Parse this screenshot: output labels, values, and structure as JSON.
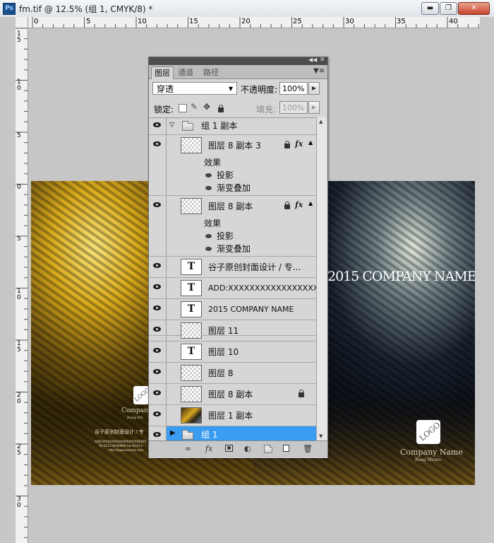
{
  "window": {
    "title": "fm.tif @ 12.5% (组 1, CMYK/8) *",
    "app_icon_label": "Ps"
  },
  "rulers": {
    "horizontal": [
      "0",
      "5",
      "10",
      "15",
      "20",
      "25",
      "30",
      "35",
      "40"
    ],
    "vertical": [
      "1\n5",
      "1\n0",
      "5",
      "0",
      "5",
      "1\n0",
      "1\n5",
      "2\n0",
      "2\n5",
      "3\n0"
    ]
  },
  "canvas": {
    "headline": "2015 COMPANY NAME",
    "logo": "LOGO",
    "company_name": "Company Name",
    "sub_name": "Rong Memo",
    "left_company": "Company",
    "left_sub": "Rong Me",
    "left_line1": "谷子原创封面设计 / 专",
    "left_line2": "ADD:XXXXXXXXXXXXXXXXXXXXXXX",
    "left_line3": "Tel:0123 00000000 Fax:0123 0",
    "left_line4": "http://www.xxxxxxx.com"
  },
  "layers_panel": {
    "tabs": [
      "图层",
      "通道",
      "路径"
    ],
    "blend_mode": "穿透",
    "opacity_label": "不透明度:",
    "opacity_value": "100%",
    "lock_label": "锁定:",
    "fill_label": "填充:",
    "fill_value": "100%",
    "group_copy": "组 1 副本",
    "layer_8_copy_3": "图层 8 副本 3",
    "effects_label": "效果",
    "drop_shadow": "投影",
    "gradient_overlay": "渐变叠加",
    "layer_8_copy": "图层 8 副本",
    "text_layer_1": "谷子原创封面设计 / 专...",
    "text_layer_2": "ADD:XXXXXXXXXXXXXXXXXX...",
    "text_layer_3": "2015 COMPANY NAME",
    "layer_11": "图层 11",
    "layer_10": "图层 10",
    "layer_8": "图层 8",
    "layer_8_copy_b": "图层 8 副本",
    "layer_1_copy": "图层 1 副本",
    "group_1": "组 1",
    "text_thumb_glyph": "T",
    "fx_glyph": "fx"
  },
  "colors": {
    "selection": "#3a9cf0",
    "panel": "#d6d6d6",
    "canvas_bg": "#c6c6c6"
  }
}
